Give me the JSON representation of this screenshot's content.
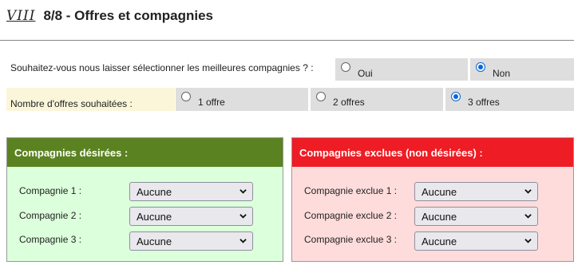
{
  "header": {
    "roman": "VIII",
    "title": "8/8 - Offres et compagnies"
  },
  "question1": {
    "label": "Souhaitez-vous nous laisser sélectionner les meilleures compagnies ?  :",
    "options": [
      {
        "label": "Oui",
        "checked": false
      },
      {
        "label": "Non",
        "checked": true
      }
    ]
  },
  "question2": {
    "label": "Nombre d'offres souhaitées :",
    "options": [
      {
        "label": "1 offre",
        "checked": false
      },
      {
        "label": "2 offres",
        "checked": false
      },
      {
        "label": "3 offres",
        "checked": true
      }
    ]
  },
  "desired": {
    "title": "Compagnies désirées :",
    "color": "#5b8221",
    "rows": [
      {
        "label": "Compagnie 1 :",
        "value": "Aucune"
      },
      {
        "label": "Compagnie 2 :",
        "value": "Aucune"
      },
      {
        "label": "Compagnie 3 :",
        "value": "Aucune"
      }
    ]
  },
  "excluded": {
    "title": "Compagnies exclues (non désirées) :",
    "color": "#ee1c24",
    "rows": [
      {
        "label": "Compagnie exclue 1 :",
        "value": "Aucune"
      },
      {
        "label": "Compagnie exclue 2 :",
        "value": "Aucune"
      },
      {
        "label": "Compagnie exclue 3 :",
        "value": "Aucune"
      }
    ]
  }
}
